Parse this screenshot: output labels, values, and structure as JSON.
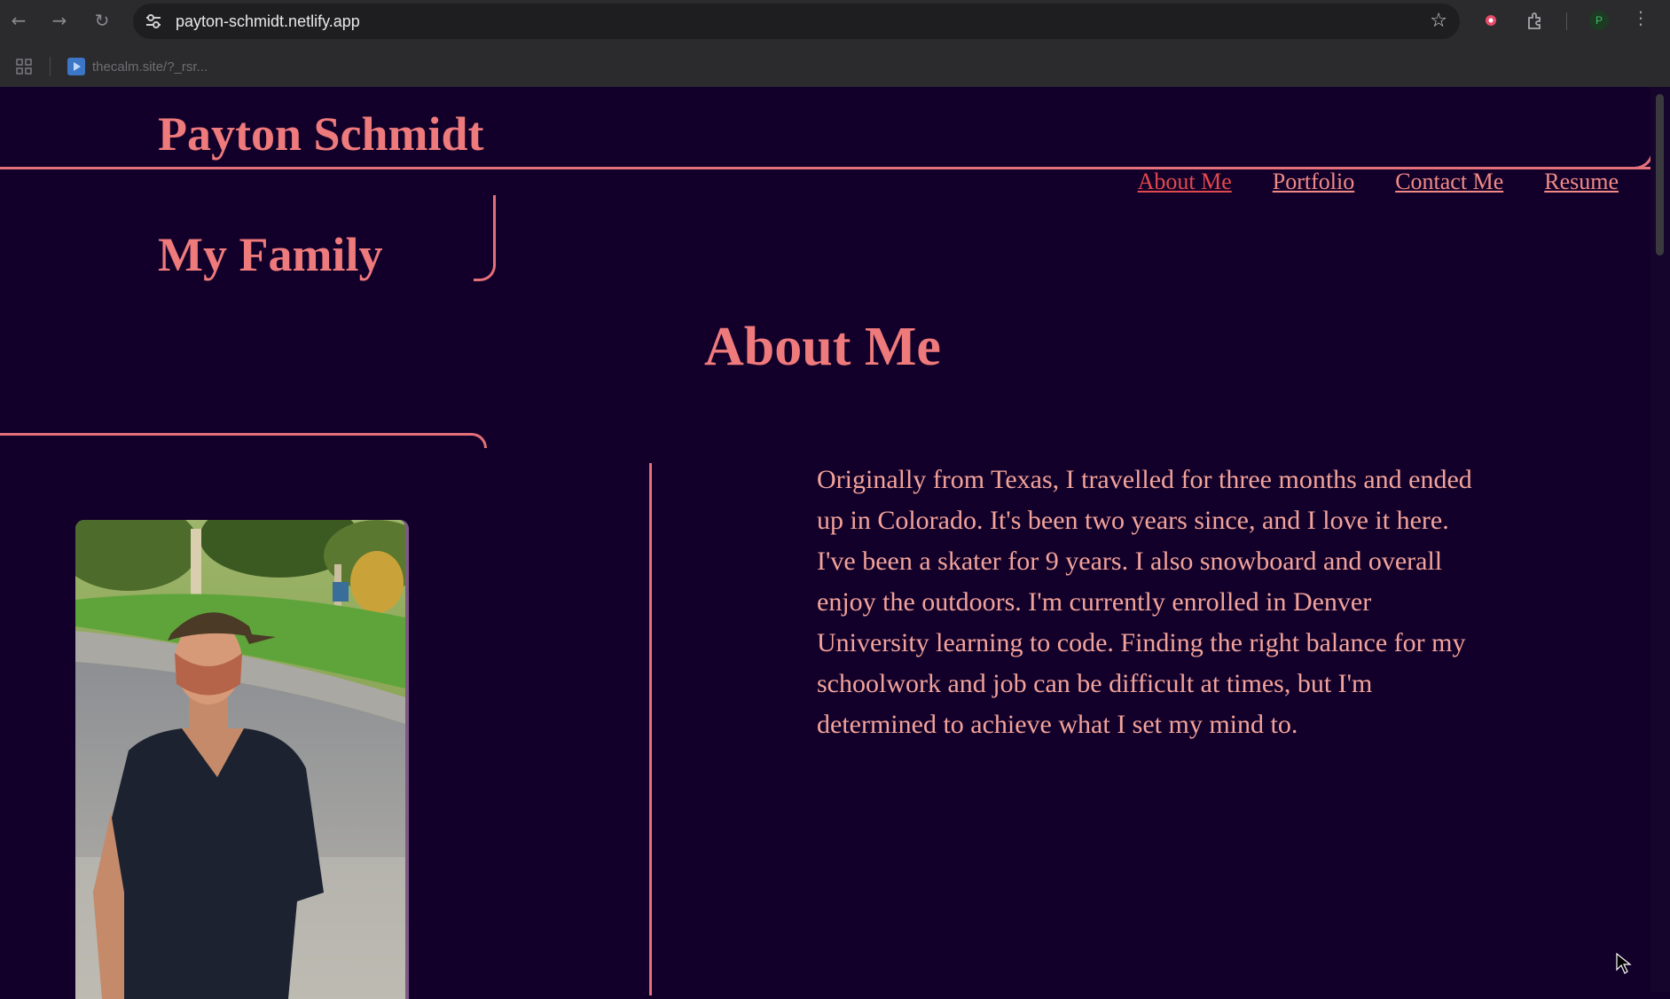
{
  "browser": {
    "url": "payton-schmidt.netlify.app",
    "bookmark_label": "thecalm.site/?_rsr...",
    "profile_initial": "P"
  },
  "header": {
    "site_title": "Payton Schmidt",
    "nav": [
      {
        "label": "About Me",
        "active": true
      },
      {
        "label": "Portfolio"
      },
      {
        "label": "Contact Me"
      },
      {
        "label": "Resume"
      }
    ]
  },
  "sidebar": {
    "title": "My Family"
  },
  "main": {
    "title": "About Me",
    "bio": "Originally from Texas, I travelled for three months and ended up in Colorado. It's been two years since, and I love it here. I've been a skater for 9 years. I also snowboard and overall enjoy the outdoors. I'm currently enrolled in Denver University learning to code. Finding the right balance for my schoolwork and job can be difficult at times, but I'm determined to achieve what I set my mind to."
  },
  "colors": {
    "background": "#13002a",
    "accent": "#ee7a7c",
    "active_link": "#e2494c",
    "text": "#f2a39a"
  }
}
